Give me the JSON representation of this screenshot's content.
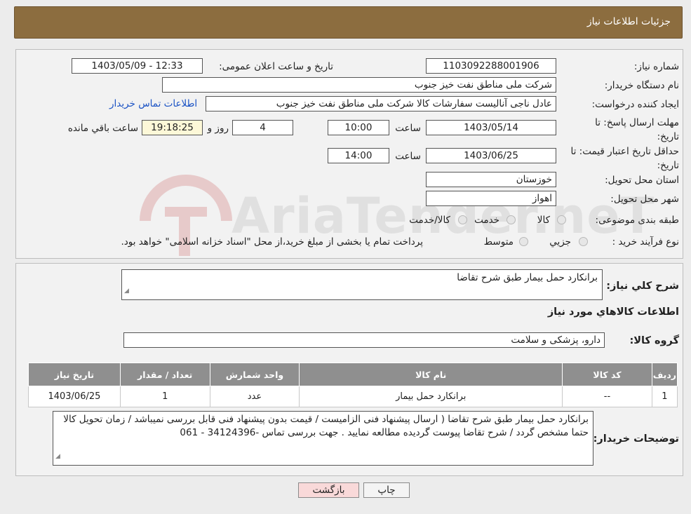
{
  "header": {
    "title": "جزئیات اطلاعات نیاز"
  },
  "form": {
    "need_number_label": "شماره نیاز:",
    "need_number": "1103092288001906",
    "announce_label": "تاریخ و ساعت اعلان عمومی:",
    "announce_value": "1403/05/09 - 12:33",
    "buyer_org_label": "نام دستگاه خریدار:",
    "buyer_org": "شرکت ملی مناطق نفت خیز جنوب",
    "creator_label": "ایجاد کننده درخواست:",
    "creator": "عادل  ناجی آنالیست سفارشات کالا  شرکت ملی مناطق نفت خیز جنوب",
    "contact_link": "اطلاعات تماس خریدار",
    "deadline_label": "مهلت ارسال پاسخ: تا تاریخ:",
    "deadline_date": "1403/05/14",
    "time_label": "ساعت",
    "deadline_time": "10:00",
    "days_value": "4",
    "days_label": "روز و",
    "remaining_value": "19:18:25",
    "remaining_label": "ساعت باقي مانده",
    "validity_label": "حداقل تاريخ اعتبار قيمت: تا تاريخ:",
    "validity_date": "1403/06/25",
    "validity_time_label": "ساعت",
    "validity_time": "14:00",
    "province_label": "استان محل تحویل:",
    "province": "خوزستان",
    "city_label": "شهر محل تحویل:",
    "city": "اهواز",
    "category_label": "طبقه بندی موضوعی:",
    "category_options": [
      "کالا",
      "خدمت",
      "کالا/خدمت"
    ],
    "purchase_type_label": "نوع فرآیند خرید :",
    "purchase_options": [
      "جزيي",
      "متوسط"
    ],
    "purchase_note": "پرداخت تمام یا بخشی از مبلغ خرید،از محل \"اسناد خزانه اسلامی\" خواهد بود."
  },
  "general": {
    "desc_label": "شرح کلي نياز:",
    "desc": "برانکارد حمل بیمار طبق شرح تقاضا",
    "goods_info_title": "اطلاعات کالاهاي مورد نياز",
    "group_label": "گروه کالا:",
    "group": "دارو، پزشکی و سلامت"
  },
  "table": {
    "headers": [
      "رديف",
      "کد کالا",
      "نام کالا",
      "واحد شمارش",
      "تعداد / مقدار",
      "تاريخ نياز"
    ],
    "rows": [
      [
        "1",
        "--",
        "برانکارد حمل بیمار",
        "عدد",
        "1",
        "1403/06/25"
      ]
    ]
  },
  "buyer_notes": {
    "label": "توضيحات خريدار:",
    "text": "برانکارد حمل بیمار طبق شرح تقاضا ( ارسال پیشنهاد فنی الزامیست / قیمت بدون پیشنهاد فنی قابل بررسی نمیباشد / زمان تحویل کالا حتما مشخص گردد / شرح تقاضا پیوست گردیده مطالعه نمایید . جهت بررسی  تماس -34124396 - 061"
  },
  "actions": {
    "print": "چاپ",
    "back": "بازگشت"
  },
  "watermark": {
    "text": "AriaTender.neT"
  },
  "colors": {
    "header": "#8c6d3f",
    "back_button": "#f9d9d9",
    "link": "#1a52c4",
    "table_header": "#8f8f8f"
  }
}
